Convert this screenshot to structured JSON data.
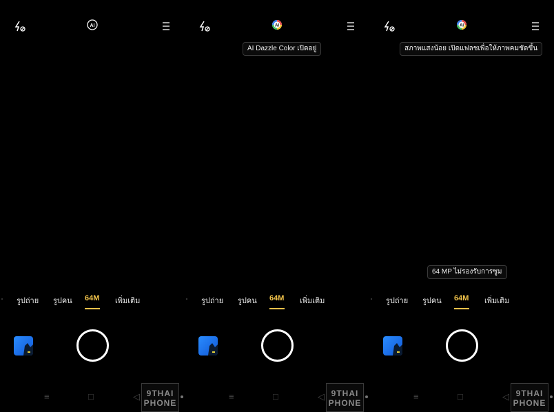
{
  "panels": [
    {
      "toast": null,
      "bottom_toast": null,
      "ai_state": "off",
      "modes": [
        "รูปถ่าย",
        "รูปคน",
        "64M",
        "เพิ่มเติม"
      ],
      "active_mode_index": 2
    },
    {
      "toast": "AI Dazzle Color เปิดอยู่",
      "bottom_toast": null,
      "ai_state": "on",
      "modes": [
        "รูปถ่าย",
        "รูปคน",
        "64M",
        "เพิ่มเติม"
      ],
      "active_mode_index": 2
    },
    {
      "toast": "สภาพแสงน้อย เปิดแฟลชเพื่อให้ภาพคมชัดขึ้น",
      "bottom_toast": "64 MP ไม่รองรับการซูม",
      "ai_state": "on",
      "modes": [
        "รูปถ่าย",
        "รูปคน",
        "64M",
        "เพิ่มเติม"
      ],
      "active_mode_index": 2
    }
  ],
  "icons": {
    "flash": "flash-off-icon",
    "ai": "ai-scene-icon",
    "menu": "menu-icon",
    "nav": [
      "menu-nav-icon",
      "home-nav-icon",
      "back-nav-icon"
    ]
  },
  "nav_glyphs": [
    "≡",
    "□",
    "◁"
  ],
  "watermark": {
    "line1": "9THAI",
    "line2": "PHONE"
  },
  "colors": {
    "accent": "#f0c24a",
    "background": "#000000"
  },
  "p0": {
    "mode_0": "รูปถ่าย",
    "mode_1": "รูปคน",
    "mode_2": "64M",
    "mode_3": "เพิ่มเติม"
  },
  "p1": {
    "toast": "AI Dazzle Color เปิดอยู่",
    "mode_0": "รูปถ่าย",
    "mode_1": "รูปคน",
    "mode_2": "64M",
    "mode_3": "เพิ่มเติม"
  },
  "p2": {
    "toast": "สภาพแสงน้อย เปิดแฟลชเพื่อให้ภาพคมชัดขึ้น",
    "bottom_toast": "64 MP ไม่รองรับการซูม",
    "mode_0": "รูปถ่าย",
    "mode_1": "รูปคน",
    "mode_2": "64M",
    "mode_3": "เพิ่มเติม"
  }
}
